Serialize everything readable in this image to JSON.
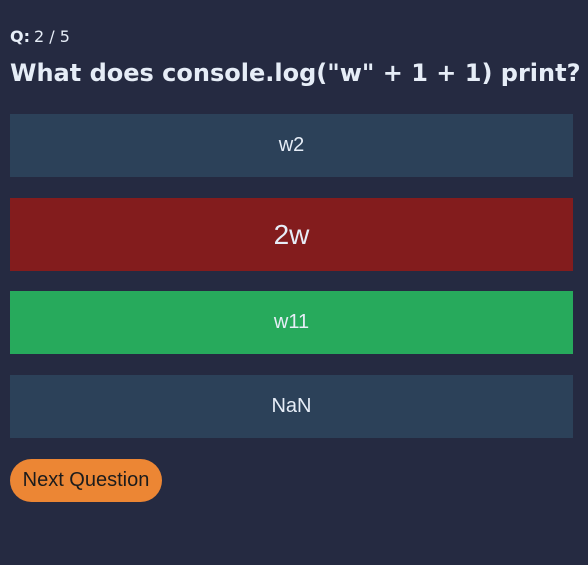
{
  "quiz": {
    "counter_label": "Q:",
    "counter_value": "2 / 5",
    "question": "What does console.log(\"w\" + 1 + 1) print?",
    "answers": [
      {
        "label": "w2",
        "state": "default",
        "color": "#2c4159"
      },
      {
        "label": "2w",
        "state": "selected-incorrect",
        "color": "#831c1d"
      },
      {
        "label": "w11",
        "state": "correct",
        "color": "#27aa5c"
      },
      {
        "label": "NaN",
        "state": "default",
        "color": "#2c4159"
      }
    ],
    "next_label": "Next Question",
    "next_color": "#ec8634",
    "background_color": "#252a41"
  }
}
